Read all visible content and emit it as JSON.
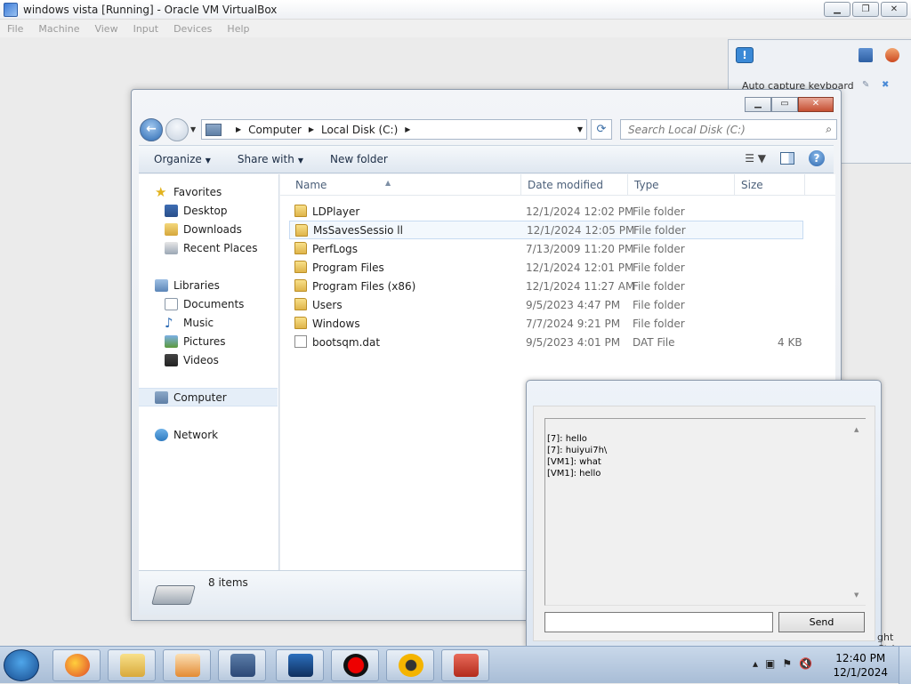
{
  "host": {
    "title": "windows vista [Running] - Oracle VM VirtualBox",
    "menu": [
      "File",
      "Machine",
      "View",
      "Input",
      "Devices",
      "Help"
    ],
    "panel_text": "Auto capture keyboard ...",
    "right_ctrl": "ght Ctrl"
  },
  "explorer": {
    "breadcrumb": [
      "Computer",
      "Local Disk (C:)"
    ],
    "search_placeholder": "Search Local Disk (C:)",
    "toolbar": {
      "organize": "Organize",
      "share": "Share with",
      "new_folder": "New folder"
    },
    "nav": {
      "favorites": "Favorites",
      "desktop": "Desktop",
      "downloads": "Downloads",
      "recent": "Recent Places",
      "libraries": "Libraries",
      "documents": "Documents",
      "music": "Music",
      "pictures": "Pictures",
      "videos": "Videos",
      "computer": "Computer",
      "network": "Network"
    },
    "columns": {
      "name": "Name",
      "date": "Date modified",
      "type": "Type",
      "size": "Size"
    },
    "files": [
      {
        "name": "LDPlayer",
        "date": "12/1/2024 12:02 PM",
        "type": "File folder",
        "size": "",
        "kind": "folder"
      },
      {
        "name": "MsSavesSessio  ll",
        "date": "12/1/2024 12:05 PM",
        "type": "File folder",
        "size": "",
        "kind": "folder"
      },
      {
        "name": "PerfLogs",
        "date": "7/13/2009 11:20 PM",
        "type": "File folder",
        "size": "",
        "kind": "folder"
      },
      {
        "name": "Program Files",
        "date": "12/1/2024 12:01 PM",
        "type": "File folder",
        "size": "",
        "kind": "folder"
      },
      {
        "name": "Program Files (x86)",
        "date": "12/1/2024 11:27 AM",
        "type": "File folder",
        "size": "",
        "kind": "folder"
      },
      {
        "name": "Users",
        "date": "9/5/2023 4:47 PM",
        "type": "File folder",
        "size": "",
        "kind": "folder"
      },
      {
        "name": "Windows",
        "date": "7/7/2024 9:21 PM",
        "type": "File folder",
        "size": "",
        "kind": "folder"
      },
      {
        "name": "bootsqm.dat",
        "date": "9/5/2023 4:01 PM",
        "type": "DAT File",
        "size": "4 KB",
        "kind": "file"
      }
    ],
    "item_count": "8 items"
  },
  "chat": {
    "messages": [
      "[7]: hello",
      "[7]: huiyui7h\\",
      "[VM1]: what",
      "[VM1]: hello"
    ],
    "input_value": "",
    "send": "Send"
  },
  "taskbar": {
    "time": "12:40 PM",
    "date": "12/1/2024"
  }
}
